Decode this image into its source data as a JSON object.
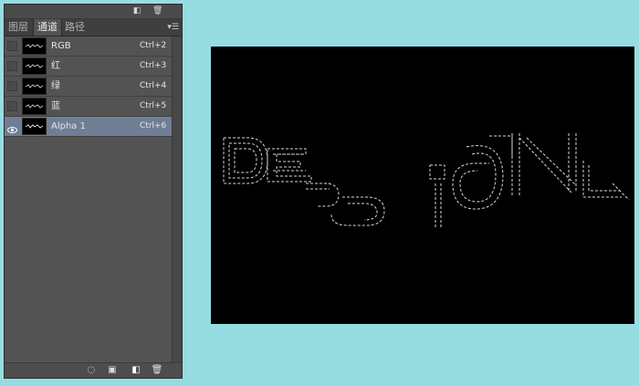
{
  "panel": {
    "tabs": [
      {
        "label": "图层"
      },
      {
        "label": "通道"
      },
      {
        "label": "路径"
      }
    ],
    "channels": [
      {
        "name": "RGB",
        "shortcut": "Ctrl+2",
        "visible": false,
        "selected": false
      },
      {
        "name": "红",
        "shortcut": "Ctrl+3",
        "visible": false,
        "selected": false
      },
      {
        "name": "绿",
        "shortcut": "Ctrl+4",
        "visible": false,
        "selected": false
      },
      {
        "name": "蓝",
        "shortcut": "Ctrl+5",
        "visible": false,
        "selected": false
      },
      {
        "name": "Alpha 1",
        "shortcut": "Ctrl+6",
        "visible": true,
        "selected": true
      }
    ],
    "top_icons": [
      "new-channel-icon",
      "trash-icon"
    ],
    "bottom_icons": [
      "load-selection-icon",
      "save-selection-icon",
      "new-channel-icon",
      "trash-icon"
    ],
    "menu_icon": "panel-menu-icon"
  },
  "canvas": {
    "text": "DESIGN"
  },
  "colors": {
    "background": "#96dde1",
    "panel": "#535353",
    "selected_row": "#6f7e94",
    "highlight": "#3fa2a5",
    "canvas": "#000000"
  }
}
